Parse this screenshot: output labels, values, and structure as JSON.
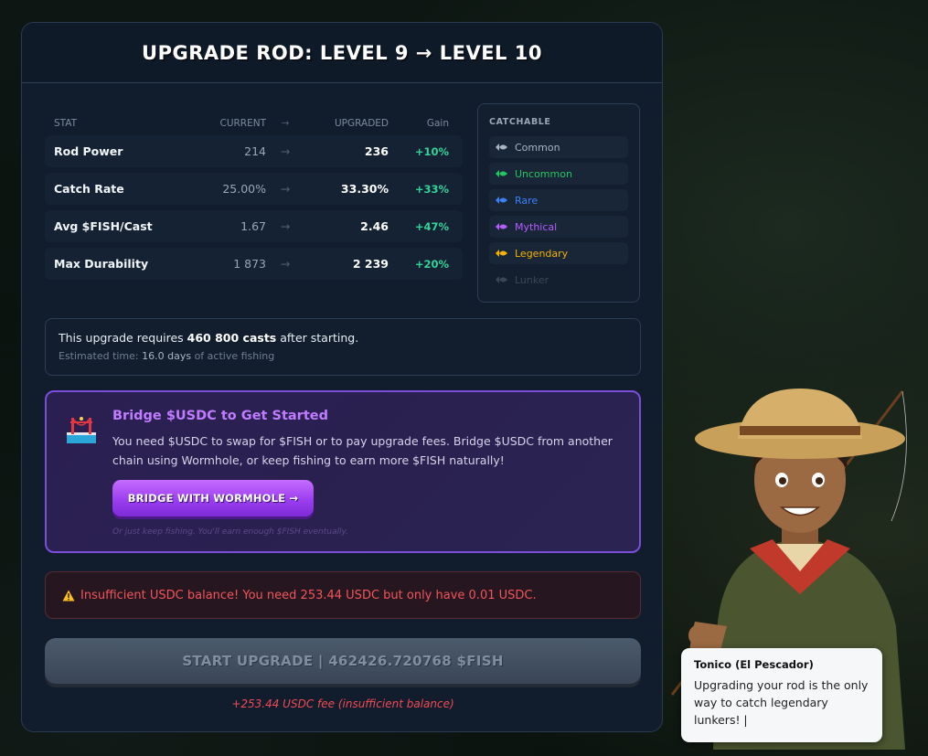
{
  "title": "UPGRADE ROD: LEVEL 9 → LEVEL 10",
  "stats": {
    "headers": {
      "stat": "STAT",
      "current": "CURRENT",
      "arrow": "→",
      "upgraded": "UPGRADED",
      "gain": "Gain"
    },
    "rows": [
      {
        "stat": "Rod Power",
        "current": "214",
        "arrow": "→",
        "upgraded": "236",
        "gain": "+10%"
      },
      {
        "stat": "Catch Rate",
        "current": "25.00%",
        "arrow": "→",
        "upgraded": "33.30%",
        "gain": "+33%"
      },
      {
        "stat": "Avg $FISH/Cast",
        "current": "1.67",
        "arrow": "→",
        "upgraded": "2.46",
        "gain": "+47%"
      },
      {
        "stat": "Max Durability",
        "current": "1 873",
        "arrow": "→",
        "upgraded": "2 239",
        "gain": "+20%"
      }
    ]
  },
  "catchable": {
    "title": "CATCHABLE",
    "items": [
      {
        "label": "Common",
        "color": "#aab4c2",
        "icon": "fish-icon"
      },
      {
        "label": "Uncommon",
        "color": "#22c55e",
        "icon": "fish-icon"
      },
      {
        "label": "Rare",
        "color": "#3b82f6",
        "icon": "fish-icon"
      },
      {
        "label": "Mythical",
        "color": "#b35cff",
        "icon": "fish-icon"
      },
      {
        "label": "Legendary",
        "color": "#f5b301",
        "icon": "fish-icon"
      },
      {
        "label": "Lunker",
        "color": "#3a4656",
        "icon": "fish-icon"
      }
    ]
  },
  "requires": {
    "prefix": "This upgrade requires ",
    "casts": "460 800 casts",
    "suffix": " after starting.",
    "est_prefix": "Estimated time: ",
    "est_value": "16.0 days",
    "est_suffix": " of active fishing"
  },
  "bridge": {
    "title": "Bridge $USDC to Get Started",
    "description": "You need $USDC to swap for $FISH or to pay upgrade fees. Bridge $USDC from another chain using Wormhole, or keep fishing to earn more $FISH naturally!",
    "button_label": "BRIDGE WITH WORMHOLE →",
    "note": "Or just keep fishing. You'll earn enough $FISH eventually."
  },
  "warning": {
    "text": "Insufficient USDC balance! You need 253.44 USDC but only have 0.01 USDC."
  },
  "start_button": {
    "label": "START UPGRADE | 462426.720768 $FISH"
  },
  "fee_note": "+253.44 USDC fee (insufficient balance)",
  "npc": {
    "name": "Tonico (El Pescador)",
    "message": "Upgrading your rod is the only way to catch legendary lunkers! |"
  },
  "colors": {
    "accent_purple": "#9b3ef0",
    "gain_green": "#34d399",
    "warning_red": "#f2555b"
  }
}
